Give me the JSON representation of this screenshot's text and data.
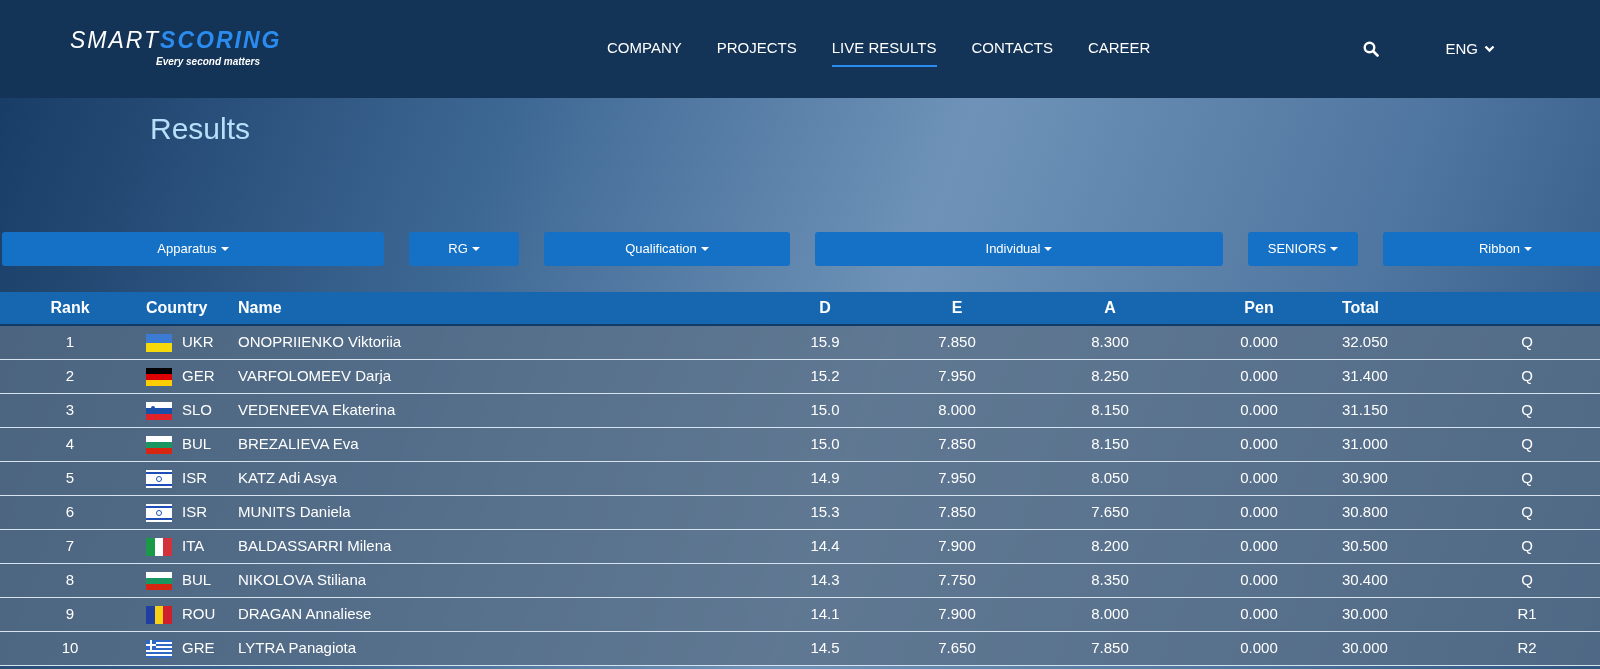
{
  "logo": {
    "wordmark_left": "SMART",
    "wordmark_right": "SCORING",
    "tagline": "Every second matters"
  },
  "nav": [
    {
      "label": "COMPANY",
      "selected": false
    },
    {
      "label": "PROJECTS",
      "selected": false
    },
    {
      "label": "LIVE RESULTS",
      "selected": true
    },
    {
      "label": "CONTACTS",
      "selected": false
    },
    {
      "label": "CAREER",
      "selected": false
    }
  ],
  "language": "ENG",
  "title": "Results",
  "filters": [
    "Apparatus",
    "RG",
    "Qualification",
    "Individual",
    "SENIORS",
    "Ribbon"
  ],
  "table": {
    "columns": [
      "Rank",
      "Country",
      "Name",
      "D",
      "E",
      "A",
      "Pen",
      "Total"
    ],
    "rows": [
      {
        "rank": "1",
        "kind": "ua",
        "country": "UKR",
        "name": "ONOPRIIENKO Viktoriia",
        "d": "15.9",
        "e": "7.850",
        "a": "8.300",
        "pen": "0.000",
        "total": "32.050",
        "status": "Q"
      },
      {
        "rank": "2",
        "kind": "de",
        "country": "GER",
        "name": "VARFOLOMEEV Darja",
        "d": "15.2",
        "e": "7.950",
        "a": "8.250",
        "pen": "0.000",
        "total": "31.400",
        "status": "Q"
      },
      {
        "rank": "3",
        "kind": "si",
        "country": "SLO",
        "name": "VEDENEEVA Ekaterina",
        "d": "15.0",
        "e": "8.000",
        "a": "8.150",
        "pen": "0.000",
        "total": "31.150",
        "status": "Q"
      },
      {
        "rank": "4",
        "kind": "bg",
        "country": "BUL",
        "name": "BREZALIEVA Eva",
        "d": "15.0",
        "e": "7.850",
        "a": "8.150",
        "pen": "0.000",
        "total": "31.000",
        "status": "Q"
      },
      {
        "rank": "5",
        "kind": "il",
        "country": "ISR",
        "name": "KATZ Adi Asya",
        "d": "14.9",
        "e": "7.950",
        "a": "8.050",
        "pen": "0.000",
        "total": "30.900",
        "status": "Q"
      },
      {
        "rank": "6",
        "kind": "il",
        "country": "ISR",
        "name": "MUNITS Daniela",
        "d": "15.3",
        "e": "7.850",
        "a": "7.650",
        "pen": "0.000",
        "total": "30.800",
        "status": "Q"
      },
      {
        "rank": "7",
        "kind": "it",
        "country": "ITA",
        "name": "BALDASSARRI Milena",
        "d": "14.4",
        "e": "7.900",
        "a": "8.200",
        "pen": "0.000",
        "total": "30.500",
        "status": "Q"
      },
      {
        "rank": "8",
        "kind": "bg",
        "country": "BUL",
        "name": "NIKOLOVA Stiliana",
        "d": "14.3",
        "e": "7.750",
        "a": "8.350",
        "pen": "0.000",
        "total": "30.400",
        "status": "Q"
      },
      {
        "rank": "9",
        "kind": "ro",
        "country": "ROU",
        "name": "DRAGAN Annaliese",
        "d": "14.1",
        "e": "7.900",
        "a": "8.000",
        "pen": "0.000",
        "total": "30.000",
        "status": "R1"
      },
      {
        "rank": "10",
        "kind": "gr",
        "country": "GRE",
        "name": "LYTRA Panagiota",
        "d": "14.5",
        "e": "7.650",
        "a": "7.850",
        "pen": "0.000",
        "total": "30.000",
        "status": "R2"
      }
    ]
  }
}
